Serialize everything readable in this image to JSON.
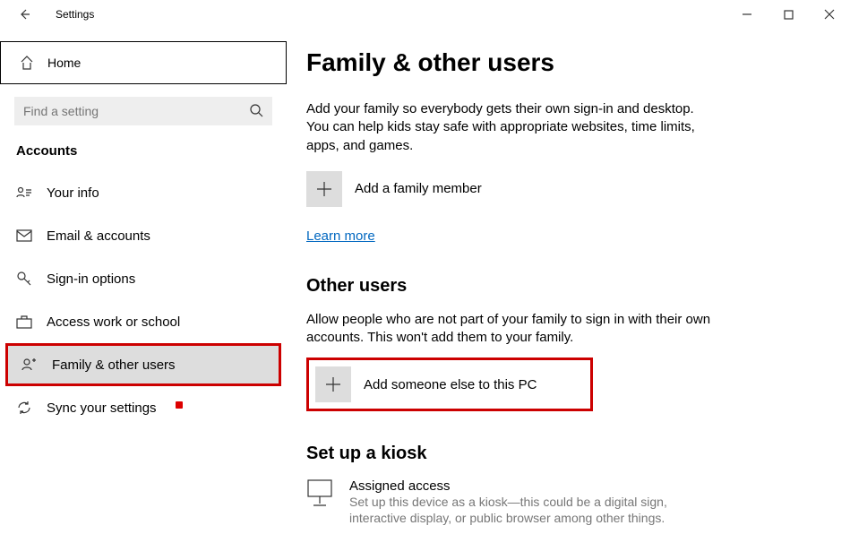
{
  "titlebar": {
    "app_name": "Settings"
  },
  "sidebar": {
    "home_label": "Home",
    "search_placeholder": "Find a setting",
    "category": "Accounts",
    "items": [
      {
        "label": "Your info"
      },
      {
        "label": "Email & accounts"
      },
      {
        "label": "Sign-in options"
      },
      {
        "label": "Access work or school"
      },
      {
        "label": "Family & other users"
      },
      {
        "label": "Sync your settings"
      }
    ]
  },
  "content": {
    "heading": "Family & other users",
    "family_desc": "Add your family so everybody gets their own sign-in and desktop. You can help kids stay safe with appropriate websites, time limits, apps, and games.",
    "add_family_label": "Add a family member",
    "learn_more": "Learn more",
    "other_heading": "Other users",
    "other_desc": "Allow people who are not part of your family to sign in with their own accounts. This won't add them to your family.",
    "add_other_label": "Add someone else to this PC",
    "kiosk_heading": "Set up a kiosk",
    "kiosk_title": "Assigned access",
    "kiosk_sub": "Set up this device as a kiosk—this could be a digital sign, interactive display, or public browser among other things."
  }
}
